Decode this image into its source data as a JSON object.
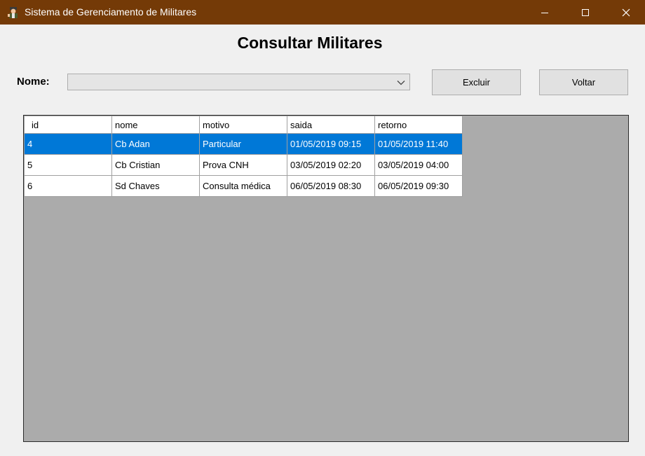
{
  "window": {
    "title": "Sistema de Gerenciamento de Militares",
    "icon": "soldier-app-icon",
    "controls": [
      "minimize-icon",
      "maximize-icon",
      "close-icon"
    ]
  },
  "page": {
    "heading": "Consultar Militares"
  },
  "form": {
    "nome_label": "Nome:",
    "nome_value": ""
  },
  "buttons": {
    "excluir": "Excluir",
    "voltar": "Voltar"
  },
  "grid": {
    "columns": [
      "id",
      "nome",
      "motivo",
      "saida",
      "retorno"
    ],
    "rows": [
      [
        "4",
        "Cb Adan",
        "Particular",
        "01/05/2019 09:15",
        "01/05/2019 11:40"
      ],
      [
        "5",
        "Cb Cristian",
        "Prova CNH",
        "03/05/2019 02:20",
        "03/05/2019 04:00"
      ],
      [
        "6",
        "Sd Chaves",
        "Consulta médica",
        "06/05/2019 08:30",
        "06/05/2019 09:30"
      ]
    ],
    "selected_row": 0
  },
  "colors": {
    "titlebar": "#743a07",
    "selection": "#0078d7",
    "grid_background": "#ababab"
  }
}
